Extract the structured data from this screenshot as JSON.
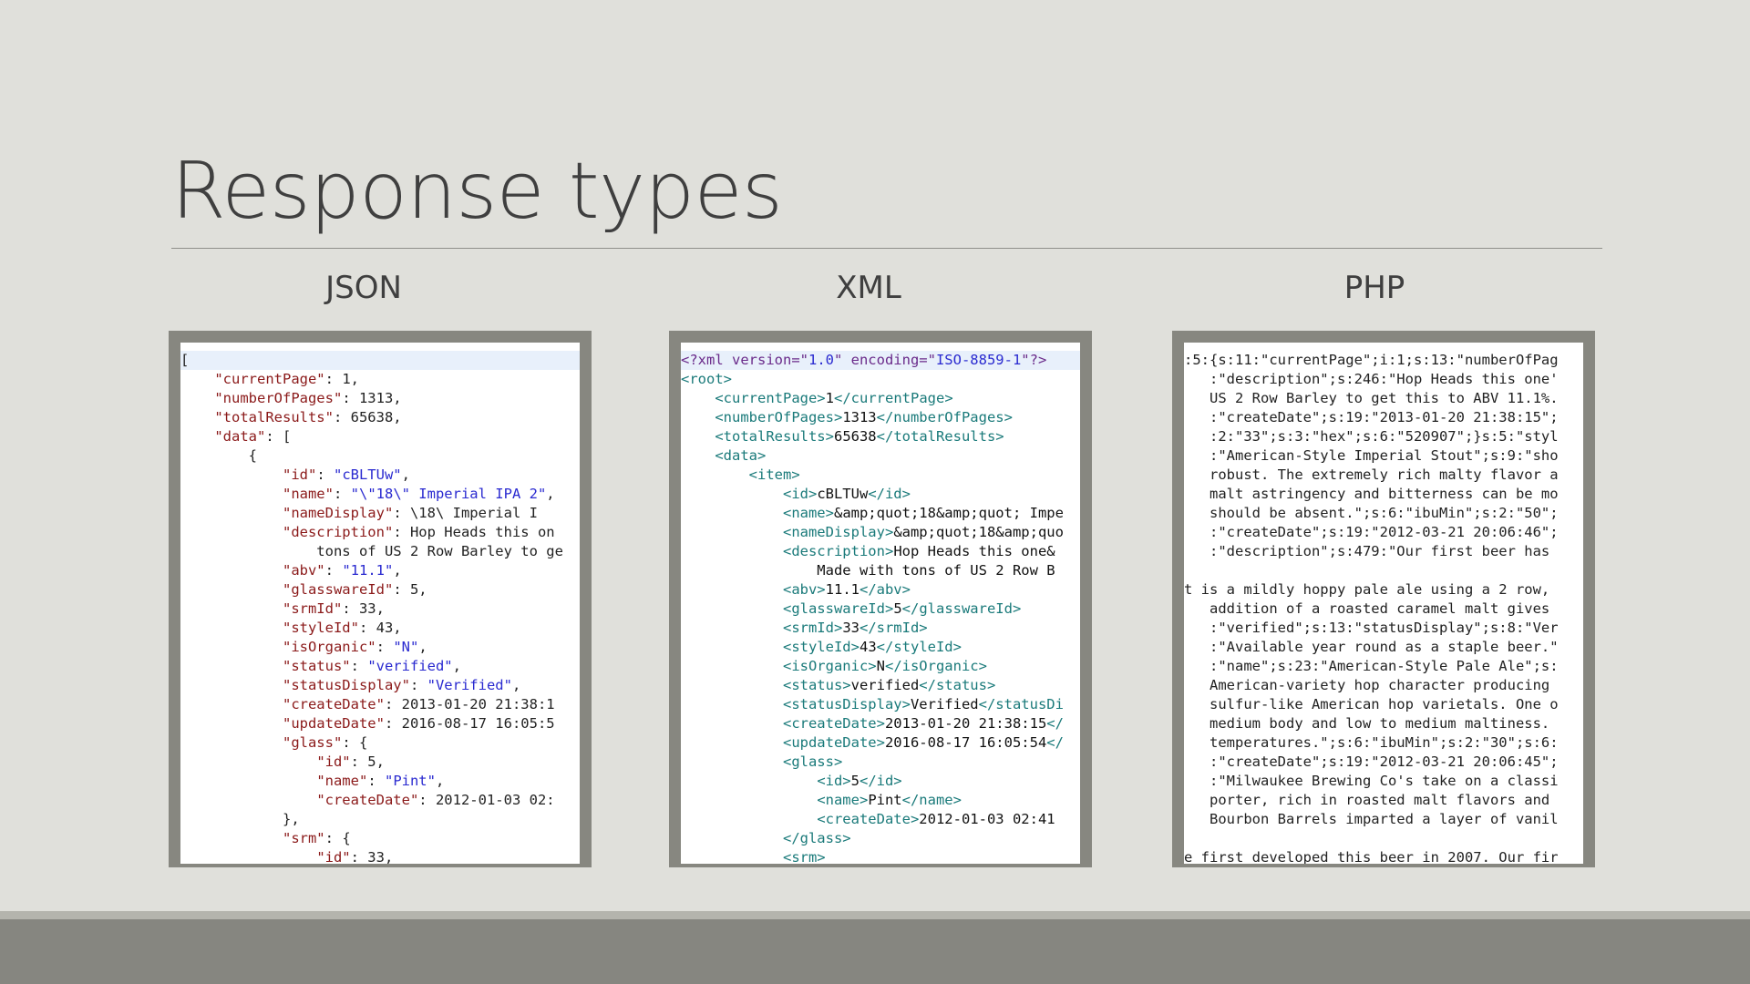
{
  "slide": {
    "title": "Response types",
    "columns": [
      "JSON",
      "XML",
      "PHP"
    ]
  },
  "json_panel": {
    "lines": [
      "[",
      "    \"currentPage\": 1,",
      "    \"numberOfPages\": 1313,",
      "    \"totalResults\": 65638,",
      "    \"data\": [",
      "        {",
      "            \"id\": \"cBLTUw\",",
      "            \"name\": \"\\\"18\\\" Imperial IPA 2\",",
      "            \"nameDisplay\": \"\\\"18\\\" Imperial I",
      "            \"description\": \"Hop Heads this on",
      "                tons of US 2 Row Barley to ge",
      "            \"abv\": \"11.1\",",
      "            \"glasswareId\": 5,",
      "            \"srmId\": 33,",
      "            \"styleId\": 43,",
      "            \"isOrganic\": \"N\",",
      "            \"status\": \"verified\",",
      "            \"statusDisplay\": \"Verified\",",
      "            \"createDate\": \"2013-01-20 21:38:1",
      "            \"updateDate\": \"2016-08-17 16:05:5",
      "            \"glass\": {",
      "                \"id\": 5,",
      "                \"name\": \"Pint\",",
      "                \"createDate\": \"2012-01-03 02:",
      "            },",
      "            \"srm\": {",
      "                \"id\": 33,"
    ]
  },
  "xml_panel": {
    "lines": [
      "<?xml version=\"1.0\" encoding=\"ISO-8859-1\"?>",
      "<root>",
      "    <currentPage>1</currentPage>",
      "    <numberOfPages>1313</numberOfPages>",
      "    <totalResults>65638</totalResults>",
      "    <data>",
      "        <item>",
      "            <id>cBLTUw</id>",
      "            <name>&amp;quot;18&amp;quot; Impe",
      "            <nameDisplay>&amp;quot;18&amp;quo",
      "            <description>Hop Heads this one&",
      "                Made with tons of US 2 Row B",
      "            <abv>11.1</abv>",
      "            <glasswareId>5</glasswareId>",
      "            <srmId>33</srmId>",
      "            <styleId>43</styleId>",
      "            <isOrganic>N</isOrganic>",
      "            <status>verified</status>",
      "            <statusDisplay>Verified</statusDi",
      "            <createDate>2013-01-20 21:38:15</",
      "            <updateDate>2016-08-17 16:05:54</",
      "            <glass>",
      "                <id>5</id>",
      "                <name>Pint</name>",
      "                <createDate>2012-01-03 02:41",
      "            </glass>",
      "            <srm>"
    ]
  },
  "php_panel": {
    "lines": [
      ":5:{s:11:\"currentPage\";i:1;s:13:\"numberOfPag",
      "   :\"description\";s:246:\"Hop Heads this one'",
      "   US 2 Row Barley to get this to ABV 11.1%.",
      "   :\"createDate\";s:19:\"2013-01-20 21:38:15\";",
      "   :2:\"33\";s:3:\"hex\";s:6:\"520907\";}s:5:\"styl",
      "   :\"American-Style Imperial Stout\";s:9:\"sho",
      "   robust. The extremely rich malty flavor a",
      "   malt astringency and bitterness can be mo",
      "   should be absent.\";s:6:\"ibuMin\";s:2:\"50\";",
      "   :\"createDate\";s:19:\"2012-03-21 20:06:46\";",
      "   :\"description\";s:479:\"Our first beer has",
      "",
      "t is a mildly hoppy pale ale using a 2 row,",
      "   addition of a roasted caramel malt gives",
      "   :\"verified\";s:13:\"statusDisplay\";s:8:\"Ver",
      "   :\"Available year round as a staple beer.\"",
      "   :\"name\";s:23:\"American-Style Pale Ale\";s:",
      "   American-variety hop character producing",
      "   sulfur-like American hop varietals. One o",
      "   medium body and low to medium maltiness.",
      "   temperatures.\";s:6:\"ibuMin\";s:2:\"30\";s:6:",
      "   :\"createDate\";s:19:\"2012-03-21 20:06:45\";",
      "   :\"Milwaukee Brewing Co's take on a classi",
      "   porter, rich in roasted malt flavors and",
      "   Bourbon Barrels imparted a layer of vanil",
      "",
      "e first developed this beer in 2007. Our fir"
    ]
  }
}
